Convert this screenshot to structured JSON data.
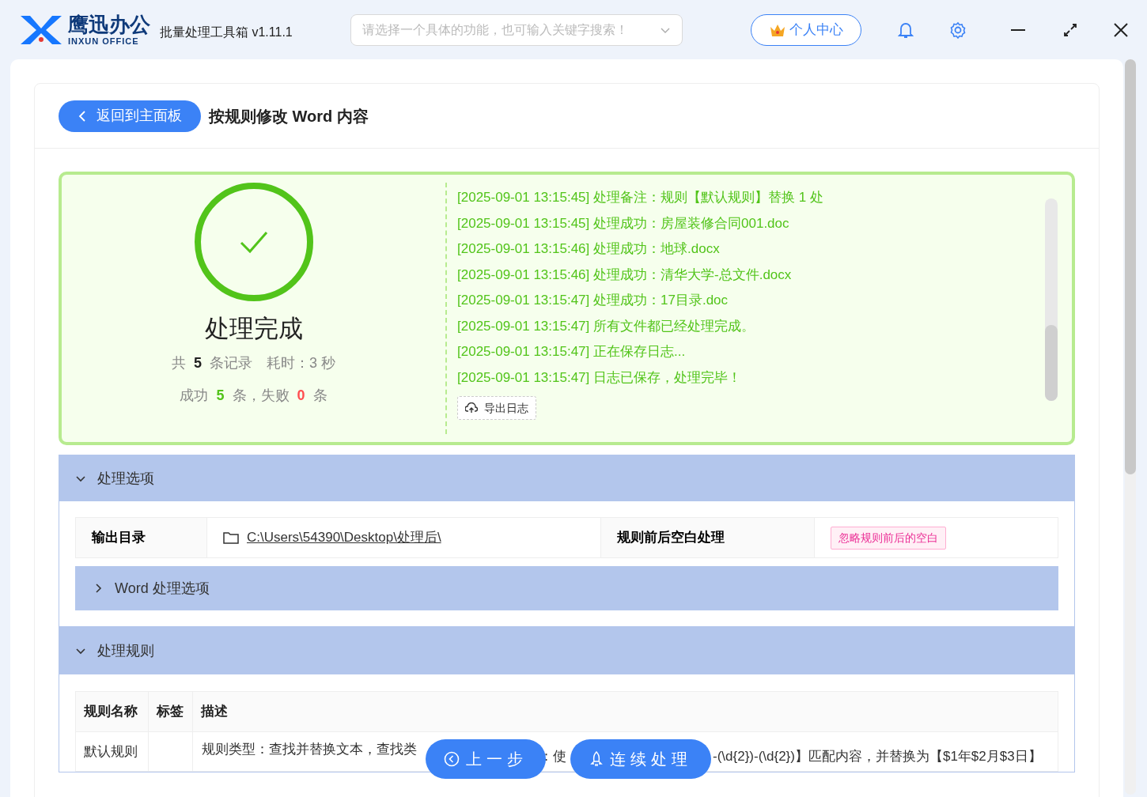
{
  "app": {
    "logo_name": "鹰迅办公",
    "logo_sub": "INXUN OFFICE",
    "title": "批量处理工具箱 v1.11.1"
  },
  "search": {
    "placeholder": "请选择一个具体的功能，也可输入关键字搜索！"
  },
  "user_button": "个人中心",
  "page": {
    "back": "返回到主面板",
    "title": "按规则修改 Word 内容"
  },
  "result": {
    "heading": "处理完成",
    "total_prefix": "共",
    "total": "5",
    "total_suffix": "条记录",
    "time": "耗时：3 秒",
    "success_prefix": "成功",
    "success": "5",
    "success_mid": "条，失败",
    "failed": "0",
    "failed_suffix": "条",
    "log": [
      "[2025-09-01 13:15:45] 处理备注：规则【默认规则】替换 1 处",
      "[2025-09-01 13:15:45] 处理成功：房屋装修合同001.doc",
      "[2025-09-01 13:15:46] 处理成功：地球.docx",
      "[2025-09-01 13:15:46] 处理成功：清华大学-总文件.docx",
      "[2025-09-01 13:15:47] 处理成功：17目录.doc",
      "[2025-09-01 13:15:47] 所有文件都已经处理完成。",
      "[2025-09-01 13:15:47] 正在保存日志...",
      "[2025-09-01 13:15:47] 日志已保存，处理完毕！"
    ],
    "export": "导出日志"
  },
  "options": {
    "title": "处理选项",
    "expanded": true,
    "output_label": "输出目录",
    "output_path": "C:\\Users\\54390\\Desktop\\处理后\\",
    "space_label": "规则前后空白处理",
    "space_tag": "忽略规则前后的空白",
    "word_options": {
      "title": "Word 处理选项",
      "expanded": false
    }
  },
  "rules": {
    "title": "处理规则",
    "expanded": true,
    "columns": [
      "规则名称",
      "标签",
      "描述"
    ],
    "rows": [
      {
        "name": "默认规则",
        "description_parts": [
          "规则类型：查找并替换文本，查找类",
          "：使",
          "-(\\d{2})-(\\d{2})】匹配内容，并替换为【$1年$2月$3日】"
        ]
      }
    ]
  },
  "buttons": {
    "prev": "上一步",
    "continue": "连续处理"
  }
}
